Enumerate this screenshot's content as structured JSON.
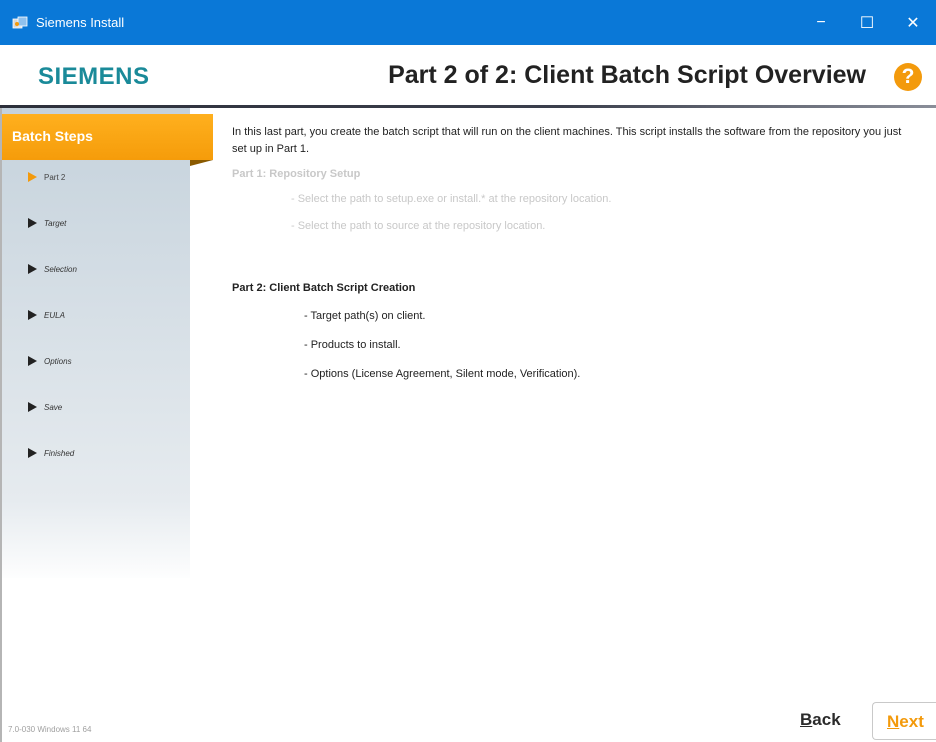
{
  "window": {
    "title": "Siemens Install",
    "controls": [
      "−",
      "☐",
      "✕"
    ]
  },
  "header": {
    "logo": "SIEMENS",
    "title": "Part 2 of 2: Client Batch Script Overview",
    "help_symbol": "?"
  },
  "sidebar": {
    "heading": "Batch Steps",
    "steps": [
      "Part 2",
      "Target",
      "Selection",
      "EULA",
      "Options",
      "Save",
      "Finished"
    ],
    "active_step": "Part 2",
    "version": "7.0-030  Windows 11 64"
  },
  "content": {
    "intro": "In this last part, you create the batch script that will run on the client machines. This script installs the software from the repository you just set up in Part 1.",
    "part1": {
      "title": "Part 1: Repository Setup",
      "items": [
        "- Select the path to setup.exe or install.* at the repository location.",
        "- Select the path to source at the repository location."
      ]
    },
    "part2": {
      "title": "Part 2: Client Batch Script Creation",
      "items": [
        "- Target path(s) on client.",
        "- Products to install.",
        "- Options (License Agreement, Silent mode, Verification)."
      ]
    }
  },
  "footer": {
    "back_first": "B",
    "back_rest": "ack",
    "next_first": "N",
    "next_rest": "ext"
  },
  "colors": {
    "titlebar": "#0a78d7",
    "accent": "#f39a0c",
    "logo": "#1a8a99"
  }
}
